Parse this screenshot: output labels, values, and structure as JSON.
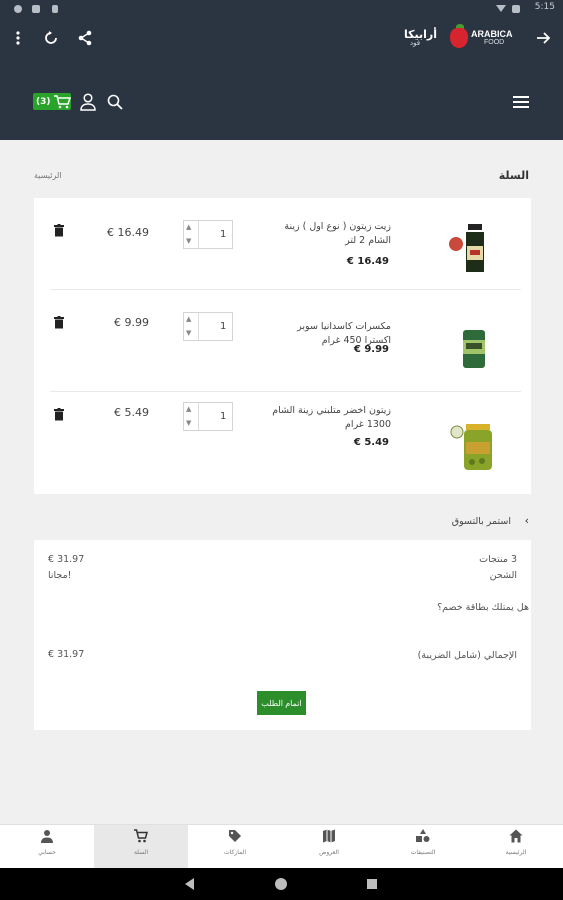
{
  "status_bar": {
    "time": "5:15"
  },
  "app_bar": {
    "logo_ar": "أرابيكا",
    "logo_ar_sub": "فود",
    "logo_en_1": "ARABICA",
    "logo_en_2": "FOOD"
  },
  "header": {
    "cart_count": "(3)"
  },
  "page": {
    "title": "السلة",
    "breadcrumb": "الرئيسية"
  },
  "cart": {
    "items": [
      {
        "name": "زيت زيتون ( نوع اول ) زينة الشام 2 لتر",
        "price": "€ 16.49",
        "qty": "1",
        "total": "€ 16.49"
      },
      {
        "name": "مكسرات كاسدانيا سوبر اكسترا 450 غرام",
        "price": "€ 9.99",
        "qty": "1",
        "total": "€ 9.99"
      },
      {
        "name": "زيتون اخضر متلبني زينة الشام 1300 غرام",
        "price": "€ 5.49",
        "qty": "1",
        "total": "€ 5.49"
      }
    ]
  },
  "continue_shopping": "استمر بالتسوق",
  "summary": {
    "products_label": "3 منتجات",
    "products_value": "€ 31.97",
    "shipping_label": "الشحن",
    "shipping_value": "مجانا!",
    "coupon_label": "هل يمتلك بطاقة خصم؟",
    "total_label": "الإجمالي (شامل الضريبة)",
    "total_value": "€ 31.97",
    "checkout_label": "اتمام الطلب"
  },
  "bottom_nav": {
    "items": [
      {
        "label": "حسابي",
        "icon": "person-icon"
      },
      {
        "label": "السلة",
        "icon": "cart-icon",
        "active": true
      },
      {
        "label": "الماركات",
        "icon": "tag-icon"
      },
      {
        "label": "العروض",
        "icon": "map-icon"
      },
      {
        "label": "التصنيفات",
        "icon": "categories-icon"
      },
      {
        "label": "الرئيسية",
        "icon": "home-icon"
      }
    ]
  },
  "colors": {
    "header_bg": "#2b3441",
    "accent_green": "#29a329",
    "brand_red": "#d8242e"
  }
}
